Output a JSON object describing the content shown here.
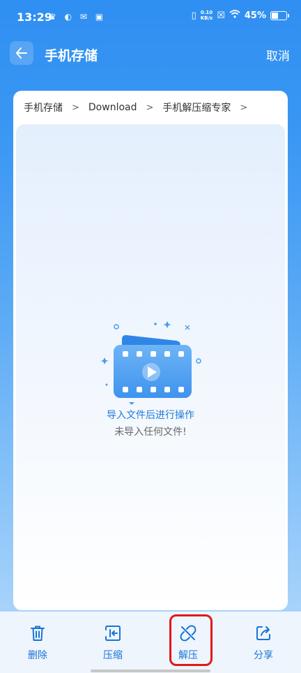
{
  "status_bar": {
    "time": "13:29",
    "net_speed_value": "0.10",
    "net_speed_unit": "KB/s",
    "battery_percent": "45%"
  },
  "header": {
    "title": "手机存储",
    "cancel_label": "取消"
  },
  "breadcrumb": [
    "手机存储",
    "Download",
    "手机解压缩专家"
  ],
  "empty_state": {
    "title": "导入文件后进行操作",
    "subtitle": "未导入任何文件!"
  },
  "toolbar": {
    "delete_label": "删除",
    "compress_label": "压缩",
    "extract_label": "解压",
    "share_label": "分享"
  },
  "colors": {
    "accent": "#1a73d6",
    "highlight": "#e11919"
  }
}
